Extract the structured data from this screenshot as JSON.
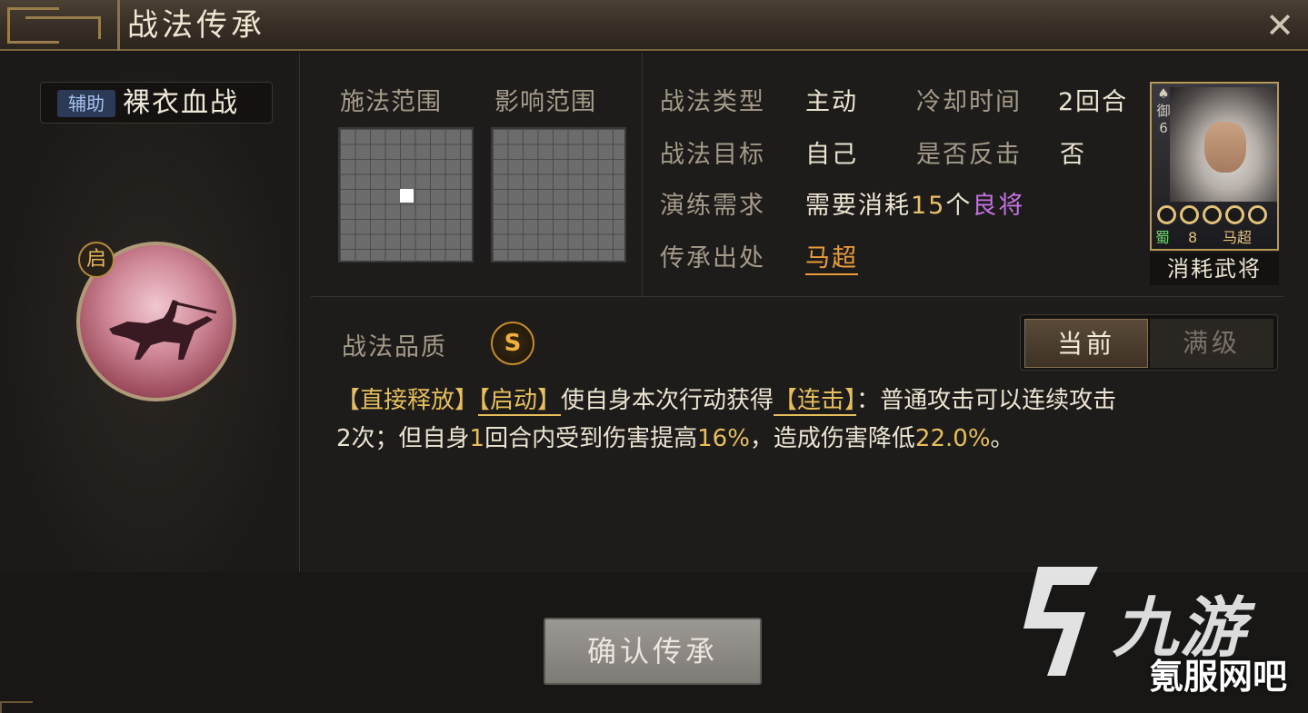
{
  "window": {
    "title": "战法传承",
    "close_icon": "close-icon"
  },
  "left": {
    "tag": "辅助",
    "skill_name": "裸衣血战",
    "badge": "启"
  },
  "ranges": {
    "cast_label": "施法范围",
    "effect_label": "影响范围"
  },
  "info": {
    "type_label": "战法类型",
    "type_value": "主动",
    "cooldown_label": "冷却时间",
    "cooldown_value": "2回合",
    "target_label": "战法目标",
    "target_value": "自己",
    "counter_label": "是否反击",
    "counter_value": "否",
    "req_label": "演练需求",
    "req_prefix": "需要消耗",
    "req_count": "15",
    "req_unit": "个",
    "req_item": "良将",
    "origin_label": "传承出处",
    "origin_value": "马超"
  },
  "hero_card": {
    "side_text": "御",
    "side_num": "6",
    "faction": "蜀",
    "cost": "8",
    "name": "马超",
    "stars": 5,
    "consume_label": "消耗武将"
  },
  "quality": {
    "label": "战法品质",
    "value": "S"
  },
  "level_toggle": {
    "current": "当前",
    "max": "满级",
    "selected": "current"
  },
  "description": {
    "t1": "【直接释放】",
    "t2": "【启动】",
    "t3": "使自身本次行动获得",
    "t4": "【连击】",
    "t5": "：普通攻击可以连续攻击",
    "t6": "2次；但自身",
    "t7": "1",
    "t8": "回合内受到伤害提高",
    "t9": "16%",
    "t10": "，造成伤害降低",
    "t11": "22.0%",
    "t12": "。"
  },
  "confirm_button": "确认传承",
  "watermark": {
    "brand": "九游",
    "sub": "氪服网吧"
  },
  "colors": {
    "accent_gold": "#e6bf5c",
    "origin_orange": "#e89b3a",
    "item_purple": "#c372e0"
  }
}
